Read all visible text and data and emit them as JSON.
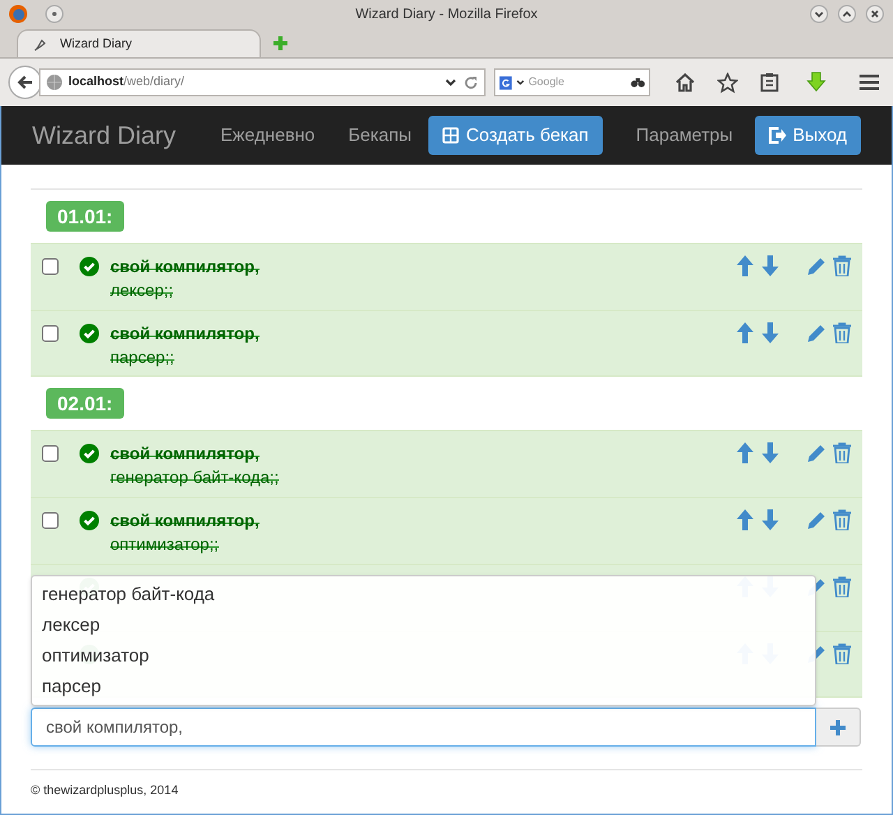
{
  "window": {
    "title": "Wizard Diary - Mozilla Firefox"
  },
  "browser": {
    "tab": "Wizard Diary",
    "url": "**localhost**/web/diary/",
    "search_placeholder": "Google"
  },
  "navbar": {
    "brand": "Wizard Diary",
    "items": [
      {
        "label": "Ежедневно",
        "kind": "link"
      },
      {
        "label": "Бекапы",
        "kind": "link"
      },
      {
        "label": "Создать бекап",
        "kind": "button"
      },
      {
        "label": "Параметры",
        "kind": "link"
      }
    ],
    "logout": "Выход"
  },
  "days": [
    {
      "label": "01.01:",
      "tasks": [
        {
          "title": "свой компилятор,",
          "detail": "лексер;;",
          "done": true,
          "checked": false
        },
        {
          "title": "свой компилятор,",
          "detail": "парсер;;",
          "done": true,
          "checked": false
        }
      ]
    },
    {
      "label": "02.01:",
      "tasks": [
        {
          "title": "свой компилятор,",
          "detail": "генератор байт-кода;;",
          "done": true,
          "checked": false
        },
        {
          "title": "свой компилятор,",
          "detail": "оптимизатор;;",
          "done": true,
          "checked": false
        },
        {
          "done": true
        },
        {
          "done": true
        }
      ]
    }
  ],
  "autocomplete": [
    "генератор байт-кода",
    "лексер",
    "оптимизатор",
    "парсер"
  ],
  "new_task": {
    "value": "свой компилятор, "
  },
  "footer": "© thewizardplusplus, 2014"
}
